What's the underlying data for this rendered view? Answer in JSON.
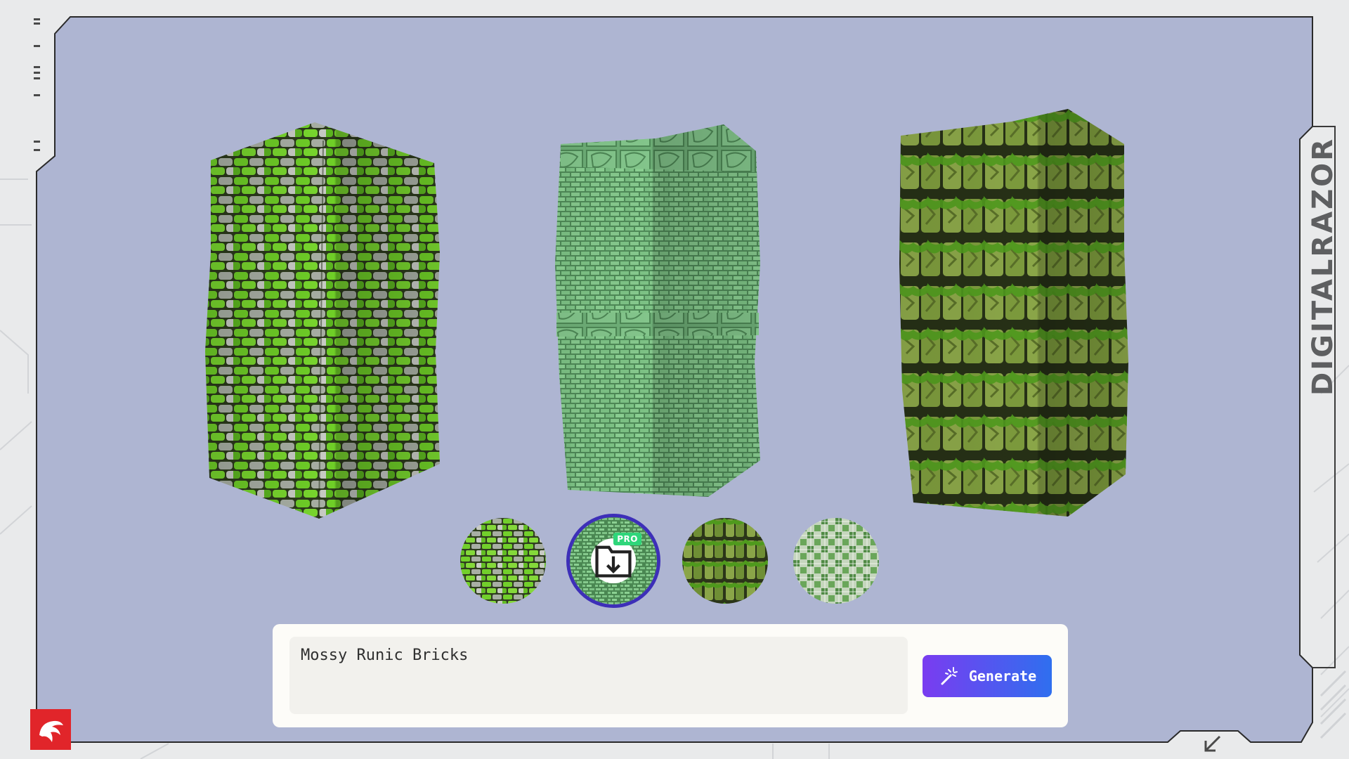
{
  "brand": {
    "text": "DIGITALRAZOR"
  },
  "pillars": [
    {
      "id": "pillar-1",
      "style": "mossy-stone-bricks"
    },
    {
      "id": "pillar-2",
      "style": "green-carved-runic-bricks"
    },
    {
      "id": "pillar-3",
      "style": "mossy-runic-stone-blocks"
    }
  ],
  "thumbnails": [
    {
      "id": "thumb-1",
      "selected": false
    },
    {
      "id": "thumb-2",
      "selected": true,
      "badge": "PRO",
      "icon": "download-icon"
    },
    {
      "id": "thumb-3",
      "selected": false
    },
    {
      "id": "thumb-4",
      "selected": false
    }
  ],
  "prompt": {
    "value": "Mossy Runic Bricks"
  },
  "generate": {
    "label": "Generate",
    "icon": "magic-wand-icon"
  },
  "colors": {
    "canvas": "#aeb5d2",
    "frame_stroke": "#2a2a2a",
    "accent_start": "#7a3cf0",
    "accent_end": "#2f6fef",
    "selected_ring": "#3d2fb8",
    "pro_badge": "#2fd67a",
    "logo_red": "#e1252a"
  }
}
